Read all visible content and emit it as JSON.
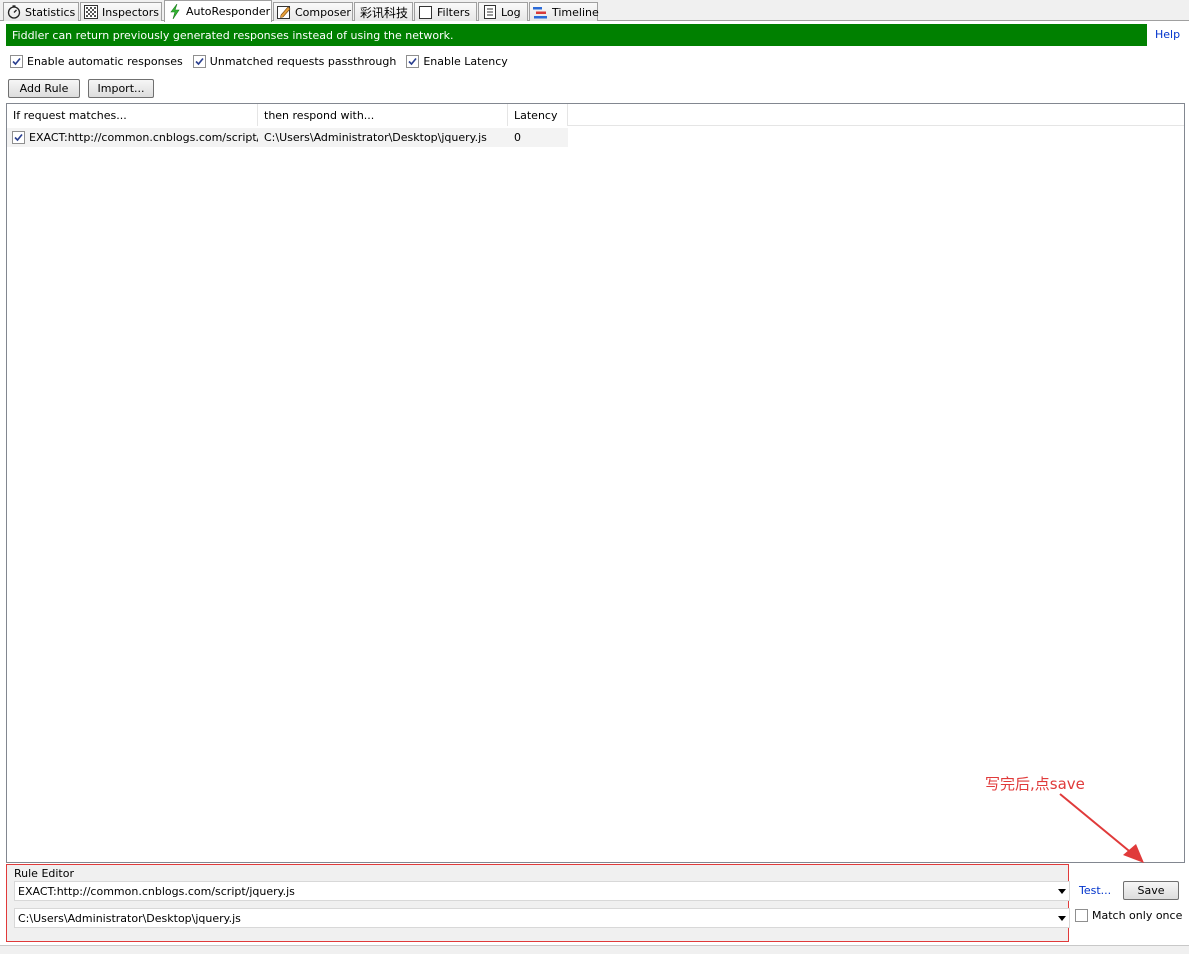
{
  "tabs": [
    {
      "label": "Statistics",
      "icon": "stopwatch-icon"
    },
    {
      "label": "Inspectors",
      "icon": "inspectors-icon"
    },
    {
      "label": "AutoResponder",
      "icon": "lightning-icon"
    },
    {
      "label": "Composer",
      "icon": "composer-icon"
    },
    {
      "label": "彩讯科技",
      "icon": ""
    },
    {
      "label": "Filters",
      "icon": "checkbox-icon"
    },
    {
      "label": "Log",
      "icon": "log-icon"
    },
    {
      "label": "Timeline",
      "icon": "timeline-icon"
    }
  ],
  "active_tab": "AutoResponder",
  "banner": {
    "text": "Fiddler can return previously generated responses instead of using the network.",
    "help": "Help",
    "color": "#008000"
  },
  "options": {
    "enable_automatic": {
      "label": "Enable automatic responses",
      "checked": true
    },
    "unmatched_passthrough": {
      "label": "Unmatched requests passthrough",
      "checked": true
    },
    "enable_latency": {
      "label": "Enable Latency",
      "checked": true
    }
  },
  "buttons": {
    "add_rule": "Add Rule",
    "import": "Import..."
  },
  "rules_table": {
    "columns": [
      "If request matches...",
      "then respond with...",
      "Latency"
    ],
    "rows": [
      {
        "checked": true,
        "match": "EXACT:http://common.cnblogs.com/script/jq...",
        "respond": "C:\\Users\\Administrator\\Desktop\\jquery.js",
        "latency": "0"
      }
    ]
  },
  "annotation": {
    "text": "写完后,点save",
    "color": "#e03a3a"
  },
  "rule_editor": {
    "label": "Rule Editor",
    "match_value": "EXACT:http://common.cnblogs.com/script/jquery.js",
    "respond_value": "C:\\Users\\Administrator\\Desktop\\jquery.js",
    "test_link": "Test...",
    "save_button": "Save",
    "match_only_once": {
      "label": "Match only once",
      "checked": false
    }
  }
}
